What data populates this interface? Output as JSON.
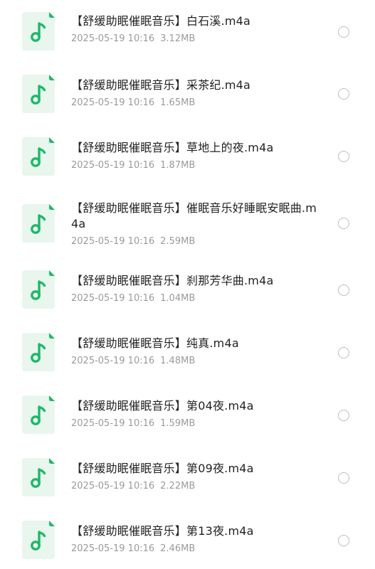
{
  "files": [
    {
      "name": "【舒缓助眠催眠音乐】白石溪.m4a",
      "date": "2025-05-19 10:16",
      "size": "3.12MB",
      "icon": "music-file-icon"
    },
    {
      "name": "【舒缓助眠催眠音乐】采茶纪.m4a",
      "date": "2025-05-19 10:16",
      "size": "1.65MB",
      "icon": "music-file-icon"
    },
    {
      "name": "【舒缓助眠催眠音乐】草地上的夜.m4a",
      "date": "2025-05-19 10:16",
      "size": "1.87MB",
      "icon": "music-file-icon"
    },
    {
      "name": "【舒缓助眠催眠音乐】催眠音乐好睡眠安眠曲.m4a",
      "date": "2025-05-19 10:16",
      "size": "2.59MB",
      "icon": "music-file-icon"
    },
    {
      "name": "【舒缓助眠催眠音乐】刹那芳华曲.m4a",
      "date": "2025-05-19 10:16",
      "size": "1.04MB",
      "icon": "music-file-icon"
    },
    {
      "name": "【舒缓助眠催眠音乐】纯真.m4a",
      "date": "2025-05-19 10:16",
      "size": "1.48MB",
      "icon": "music-file-icon"
    },
    {
      "name": "【舒缓助眠催眠音乐】第04夜.m4a",
      "date": "2025-05-19 10:16",
      "size": "1.59MB",
      "icon": "music-file-icon"
    },
    {
      "name": "【舒缓助眠催眠音乐】第09夜.m4a",
      "date": "2025-05-19 10:16",
      "size": "2.22MB",
      "icon": "music-file-icon"
    },
    {
      "name": "【舒缓助眠催眠音乐】第13夜.m4a",
      "date": "2025-05-19 10:16",
      "size": "2.46MB",
      "icon": "music-file-icon"
    }
  ],
  "colors": {
    "icon_background": "#e8f6ee",
    "icon_accent": "#1fb868",
    "file_name": "#222222",
    "meta_text": "#9a9a9a",
    "radio_border": "#bdbdbd"
  }
}
